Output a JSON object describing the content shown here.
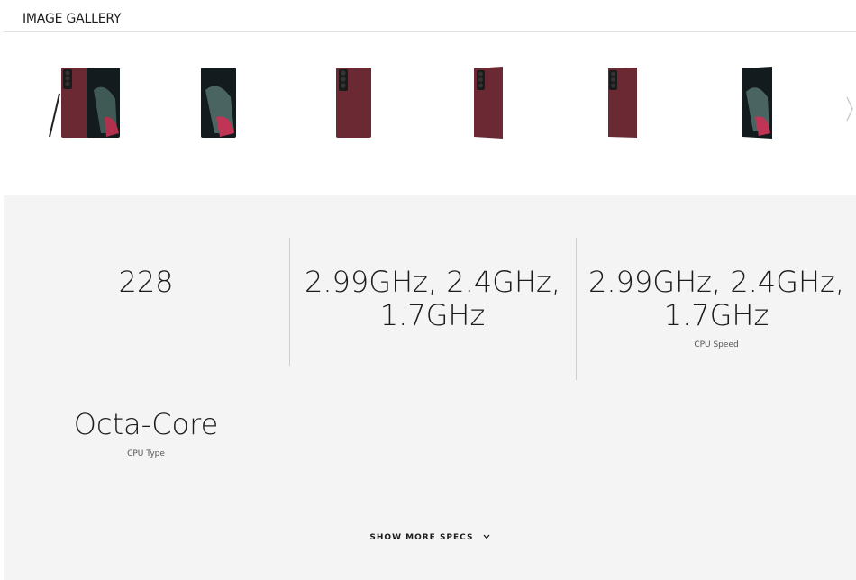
{
  "gallery": {
    "title": "IMAGE GALLERY",
    "thumbnails": [
      "front-back-with-pen",
      "front",
      "back",
      "back-angled",
      "back-side",
      "front-angled"
    ]
  },
  "specs": {
    "items": [
      {
        "value": "228",
        "label": ""
      },
      {
        "value_line1": "2.99GHz, 2.4GHz,",
        "value_line2": "1.7GHz",
        "label": ""
      },
      {
        "value_line1": "2.99GHz, 2.4GHz,",
        "value_line2": "1.7GHz",
        "label": "CPU Speed"
      },
      {
        "value": "Octa-Core",
        "label": "CPU Type"
      }
    ],
    "show_more": "SHOW MORE SPECS"
  },
  "colors": {
    "phone_body": "#6b2a33",
    "screen_dark": "#0f1518",
    "specs_bg": "#f4f4f4"
  },
  "icons": {
    "next": "chevron-right-icon",
    "expand": "chevron-down-icon"
  }
}
